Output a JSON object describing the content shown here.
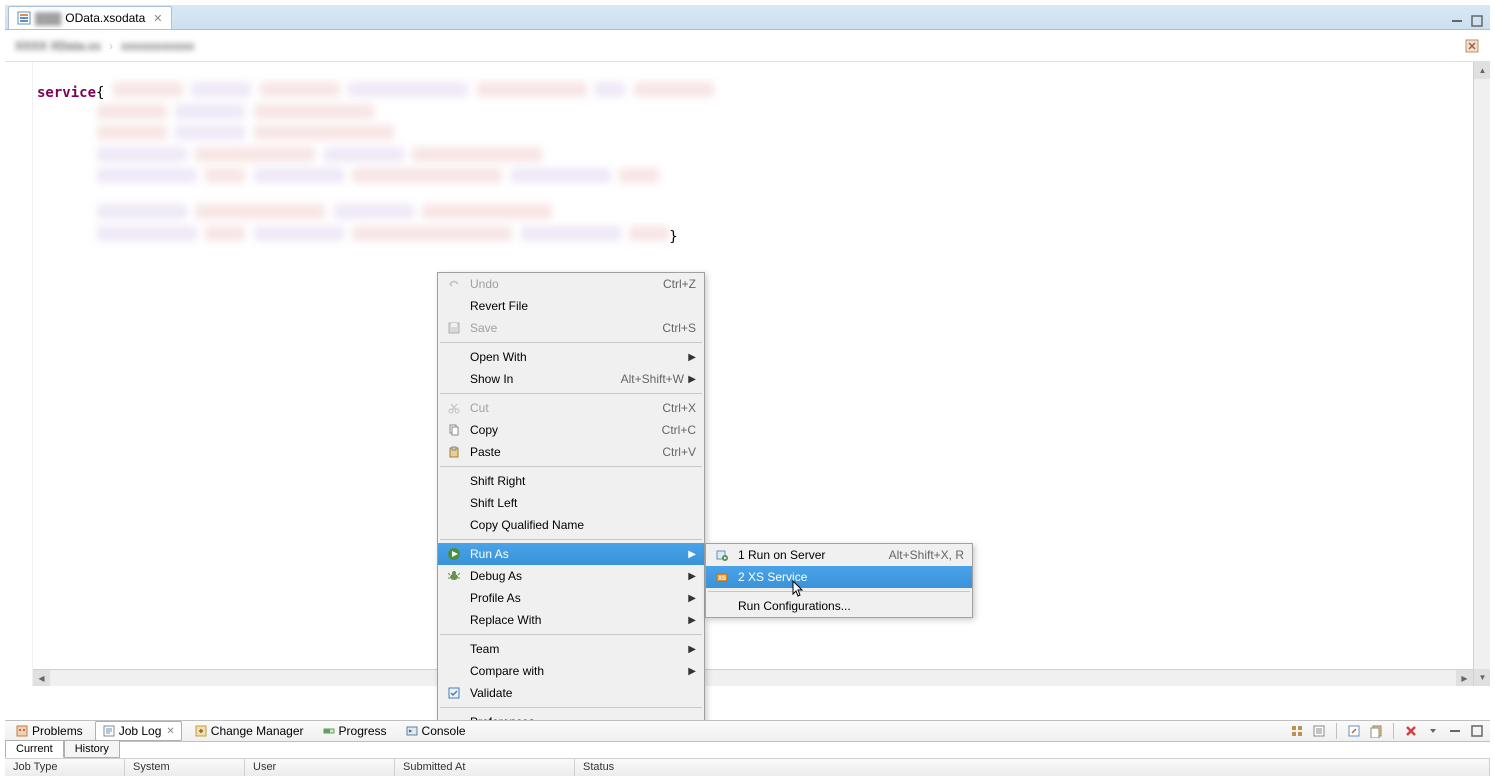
{
  "editor_tab": {
    "label": "OData.xsodata",
    "close_icon": "close"
  },
  "breadcrumb": {
    "blurred_text_1": "XXXX XData.xx",
    "blurred_text_2": "xxxxxxxxxxx"
  },
  "editor": {
    "keyword": "service",
    "open_brace": "{",
    "close_brace": "}"
  },
  "context_menu": {
    "undo": {
      "label": "Undo",
      "shortcut": "Ctrl+Z"
    },
    "revert": {
      "label": "Revert File"
    },
    "save": {
      "label": "Save",
      "shortcut": "Ctrl+S"
    },
    "open_with": {
      "label": "Open With"
    },
    "show_in": {
      "label": "Show In",
      "shortcut": "Alt+Shift+W"
    },
    "cut": {
      "label": "Cut",
      "shortcut": "Ctrl+X"
    },
    "copy": {
      "label": "Copy",
      "shortcut": "Ctrl+C"
    },
    "paste": {
      "label": "Paste",
      "shortcut": "Ctrl+V"
    },
    "shift_right": {
      "label": "Shift Right"
    },
    "shift_left": {
      "label": "Shift Left"
    },
    "copy_qualified": {
      "label": "Copy Qualified Name"
    },
    "run_as": {
      "label": "Run As"
    },
    "debug_as": {
      "label": "Debug As"
    },
    "profile_as": {
      "label": "Profile As"
    },
    "replace_with": {
      "label": "Replace With"
    },
    "team": {
      "label": "Team"
    },
    "compare_with": {
      "label": "Compare with"
    },
    "validate": {
      "label": "Validate"
    },
    "preferences": {
      "label": "Preferences..."
    }
  },
  "run_submenu": {
    "run_on_server": {
      "label": "1 Run on Server",
      "shortcut": "Alt+Shift+X, R"
    },
    "xs_service": {
      "label": "2 XS Service"
    },
    "run_configurations": {
      "label": "Run Configurations..."
    }
  },
  "bottom_views": {
    "problems": "Problems",
    "job_log": "Job Log",
    "change_manager": "Change Manager",
    "progress": "Progress",
    "console": "Console"
  },
  "sub_tabs": {
    "current": "Current",
    "history": "History"
  },
  "table_columns": {
    "job_type": "Job Type",
    "system": "System",
    "user": "User",
    "submitted_at": "Submitted At",
    "status": "Status"
  }
}
